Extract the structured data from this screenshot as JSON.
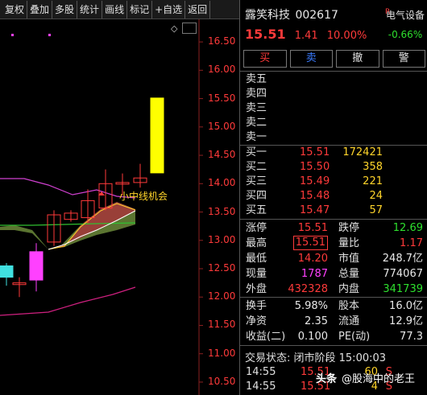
{
  "toolbar": {
    "items": [
      "复权",
      "叠加",
      "多股",
      "统计",
      "画线",
      "标记",
      "+自选",
      "返回"
    ]
  },
  "chart": {
    "y_axis_labels": [
      "16.50",
      "16.00",
      "15.50",
      "15.00",
      "14.50",
      "14.00",
      "13.50",
      "13.00",
      "12.50",
      "12.00",
      "11.50",
      "11.00",
      "10.50"
    ],
    "annotation": "小中线机会"
  },
  "chart_data": {
    "type": "candlestick",
    "ylim": [
      10.4,
      16.7
    ],
    "candles": [
      {
        "open": 12.35,
        "high": 12.6,
        "low": 12.2,
        "close": 12.55,
        "color": "cyan"
      },
      {
        "open": 12.22,
        "high": 12.35,
        "low": 12.0,
        "close": 12.25,
        "color": "red"
      },
      {
        "open": 12.3,
        "high": 12.95,
        "low": 12.1,
        "close": 12.8,
        "color": "magenta"
      },
      {
        "open": 12.97,
        "high": 13.53,
        "low": 12.9,
        "close": 13.45,
        "color": "red"
      },
      {
        "open": 13.37,
        "high": 13.53,
        "low": 13.33,
        "close": 13.48,
        "color": "red"
      },
      {
        "open": 13.4,
        "high": 13.9,
        "low": 13.3,
        "close": 13.7,
        "color": "red"
      },
      {
        "open": 13.57,
        "high": 14.25,
        "low": 13.53,
        "close": 14.0,
        "color": "red"
      },
      {
        "open": 14.0,
        "high": 14.18,
        "low": 13.79,
        "close": 14.02,
        "color": "red"
      },
      {
        "open": 14.02,
        "high": 14.35,
        "low": 13.93,
        "close": 14.1,
        "color": "red"
      },
      {
        "open": 14.19,
        "high": 15.51,
        "low": 14.19,
        "close": 15.51,
        "color": "yellow"
      }
    ]
  },
  "stock": {
    "name": "露笑科技",
    "code": "002617",
    "badge": "R",
    "price": "15.51",
    "change": "1.41",
    "change_pct": "10.00%",
    "sector_name": "电气设备",
    "sector_change": "-0.66%"
  },
  "actions": [
    "买",
    "卖",
    "撤",
    "警"
  ],
  "sell_orders": [
    {
      "label": "卖五",
      "price": "",
      "volume": ""
    },
    {
      "label": "卖四",
      "price": "",
      "volume": ""
    },
    {
      "label": "卖三",
      "price": "",
      "volume": ""
    },
    {
      "label": "卖二",
      "price": "",
      "volume": ""
    },
    {
      "label": "卖一",
      "price": "",
      "volume": ""
    }
  ],
  "buy_orders": [
    {
      "label": "买一",
      "price": "15.51",
      "volume": "172421"
    },
    {
      "label": "买二",
      "price": "15.50",
      "volume": "358"
    },
    {
      "label": "买三",
      "price": "15.49",
      "volume": "221"
    },
    {
      "label": "买四",
      "price": "15.48",
      "volume": "24"
    },
    {
      "label": "买五",
      "price": "15.47",
      "volume": "57"
    }
  ],
  "stats1": [
    {
      "l1": "涨停",
      "v1": "15.51",
      "c1": "red",
      "l2": "跌停",
      "v2": "12.69",
      "c2": "green"
    },
    {
      "l1": "最高",
      "v1": "15.51",
      "c1": "red",
      "l2": "量比",
      "v2": "1.17",
      "c2": "red"
    },
    {
      "l1": "最低",
      "v1": "14.20",
      "c1": "red",
      "l2": "市值",
      "v2": "248.7亿",
      "c2": "white"
    },
    {
      "l1": "现量",
      "v1": "1787",
      "c1": "purple",
      "l2": "总量",
      "v2": "774067",
      "c2": "white"
    },
    {
      "l1": "外盘",
      "v1": "432328",
      "c1": "red",
      "l2": "内盘",
      "v2": "341739",
      "c2": "green"
    }
  ],
  "stats2": [
    {
      "l1": "换手",
      "v1": "5.98%",
      "l2": "股本",
      "v2": "16.0亿"
    },
    {
      "l1": "净资",
      "v1": "2.35",
      "l2": "流通",
      "v2": "12.9亿"
    },
    {
      "l1": "收益(二)",
      "v1": "0.100",
      "l2": "PE(动)",
      "v2": "77.3"
    }
  ],
  "trade_status": "交易状态: 闭市阶段 15:00:03",
  "ticks": [
    {
      "time": "14:55",
      "price": "15.51",
      "volume": "60",
      "side": "S"
    },
    {
      "time": "14:55",
      "price": "15.51",
      "volume": "4",
      "side": "S"
    }
  ],
  "watermark": {
    "brand": "头条",
    "text": "@股海中的老王"
  }
}
